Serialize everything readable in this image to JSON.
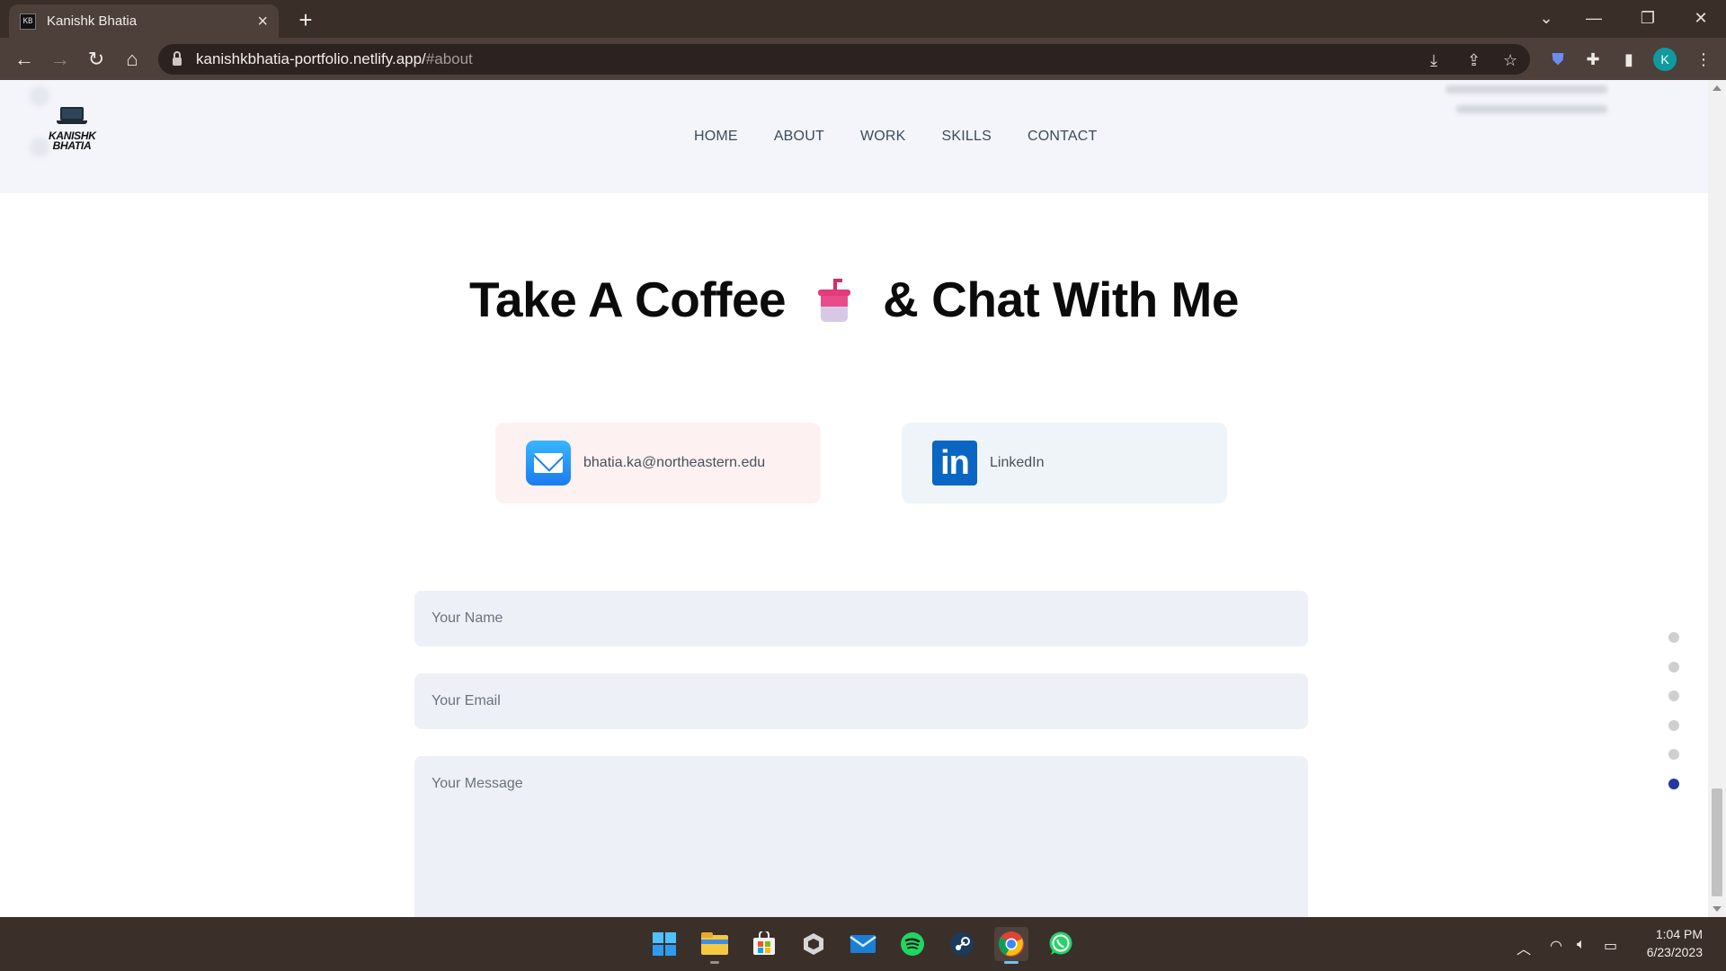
{
  "browser": {
    "tab_title": "Kanishk Bhatia",
    "tab_favicon": "KB",
    "url_host": "kanishkbhatia-portfolio.netlify.app/",
    "url_path": "#about",
    "profile_initial": "K"
  },
  "site": {
    "logo_text_line1": "KANISHK",
    "logo_text_line2": "BHATIA",
    "nav": [
      "HOME",
      "ABOUT",
      "WORK",
      "SKILLS",
      "CONTACT"
    ],
    "heading_before": "Take A Coffee",
    "heading_after": "& Chat With Me",
    "contacts": {
      "email_label": "bhatia.ka@northeastern.edu",
      "linkedin_label": "LinkedIn"
    },
    "form": {
      "name_placeholder": "Your Name",
      "email_placeholder": "Your Email",
      "message_placeholder": "Your Message"
    },
    "section_dots": {
      "count": 6,
      "active_index": 5
    }
  },
  "taskbar": {
    "apps": [
      "windows-start",
      "file-explorer",
      "microsoft-store",
      "unity-hub",
      "mail",
      "spotify",
      "steam",
      "chrome",
      "whatsapp"
    ],
    "active_app": "chrome",
    "time": "1:04 PM",
    "date": "6/23/2023"
  },
  "colors": {
    "accent_dot": "#25369e",
    "linkedin": "#0a66c2",
    "email_card_bg": "#fdf1f2",
    "linkedin_card_bg": "#eff4f9"
  }
}
